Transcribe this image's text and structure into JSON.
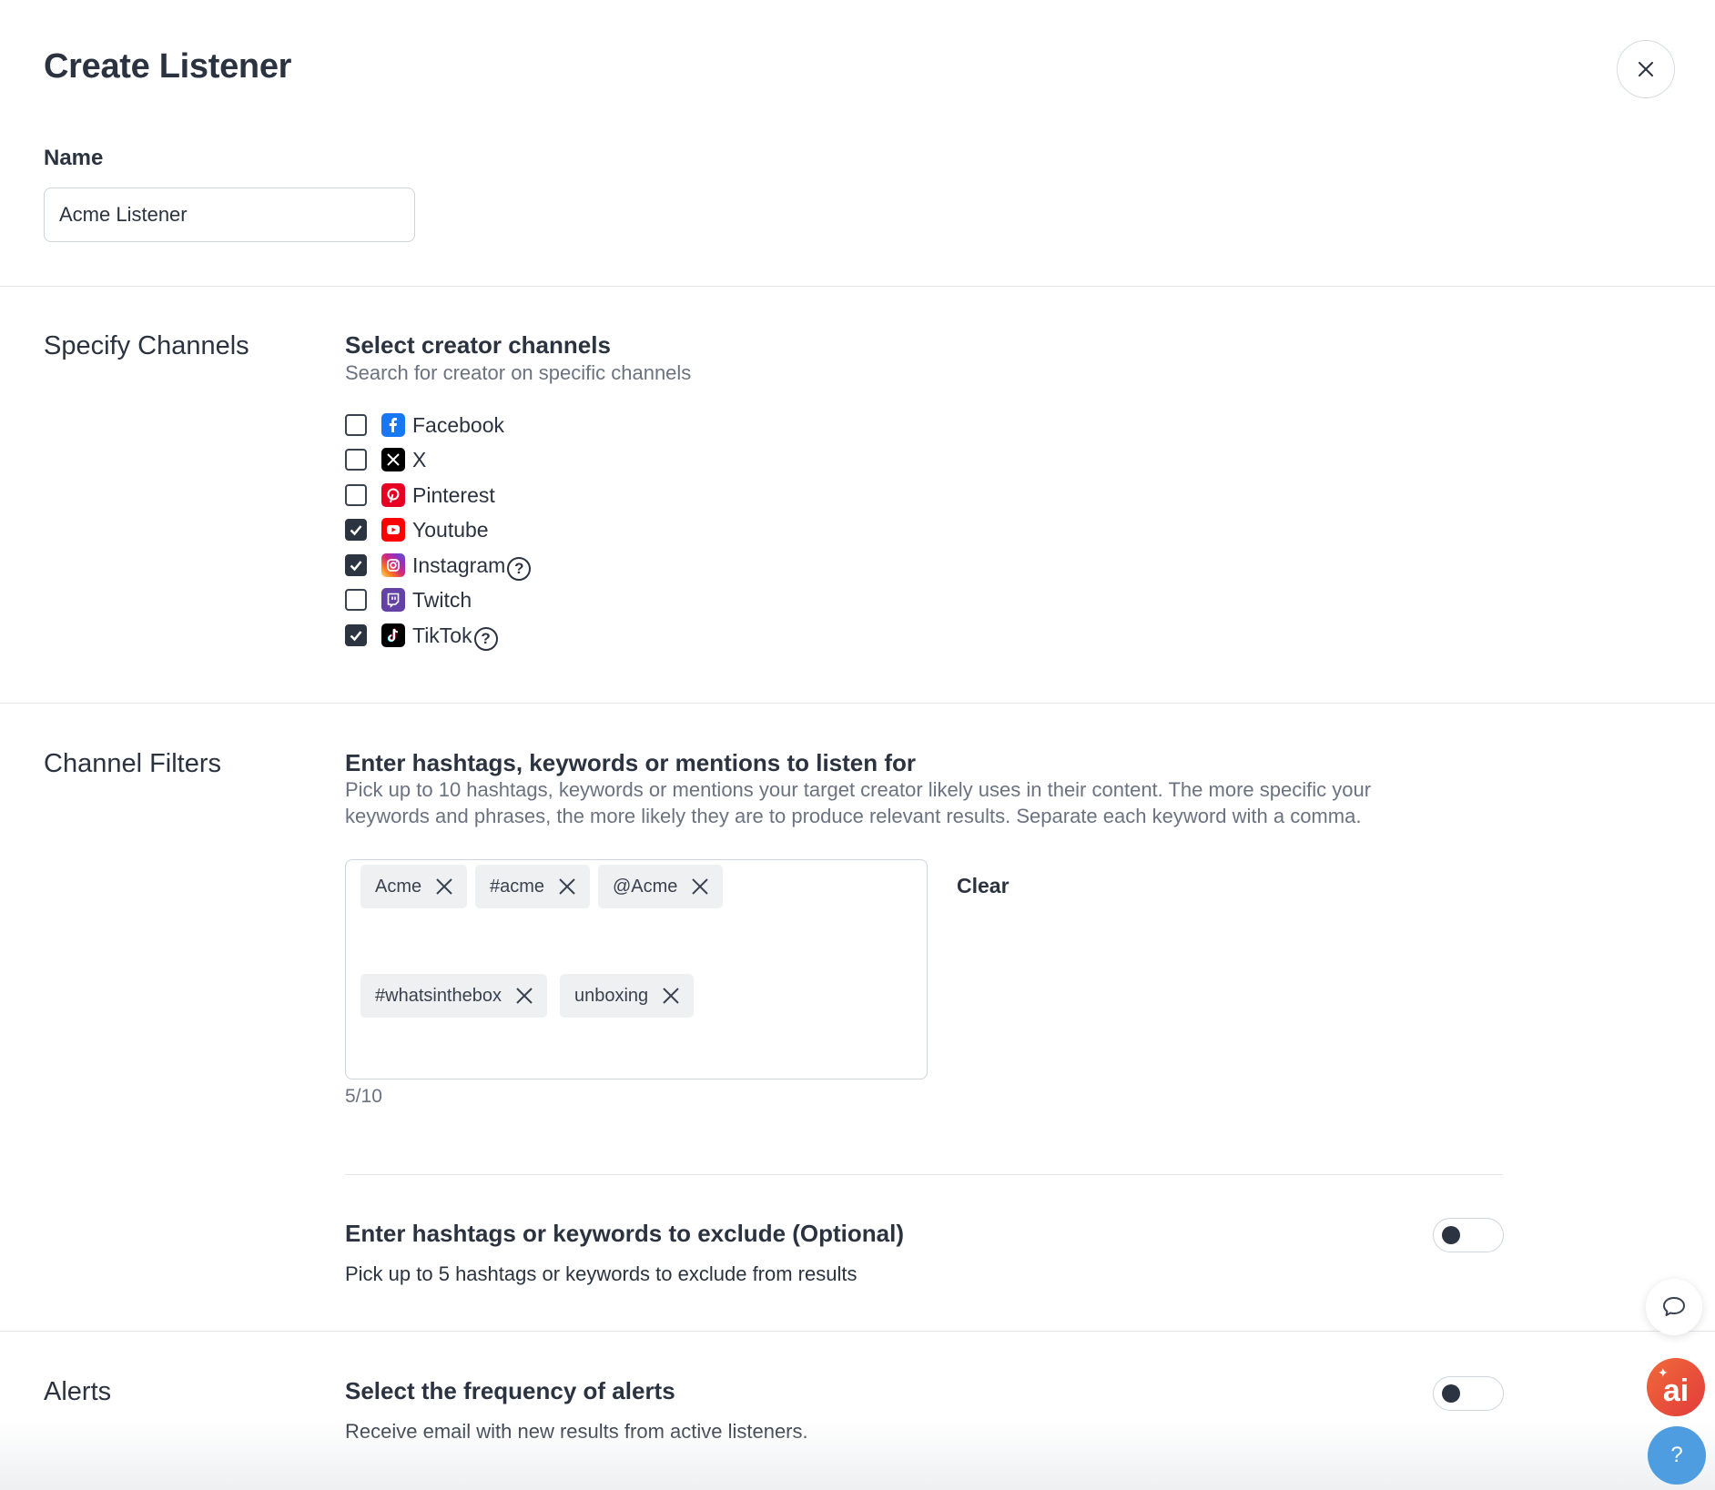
{
  "header": {
    "title": "Create Listener"
  },
  "name_field": {
    "label": "Name",
    "value": "Acme Listener"
  },
  "channels": {
    "section_title": "Specify Channels",
    "heading": "Select creator channels",
    "description": "Search for creator on specific channels",
    "items": [
      {
        "label": "Facebook",
        "checked": false,
        "icon": "facebook-icon",
        "color": "#1877f2",
        "help": false
      },
      {
        "label": "X",
        "checked": false,
        "icon": "x-icon",
        "color": "#000000",
        "help": false
      },
      {
        "label": "Pinterest",
        "checked": false,
        "icon": "pinterest-icon",
        "color": "#e60023",
        "help": false
      },
      {
        "label": "Youtube",
        "checked": true,
        "icon": "youtube-icon",
        "color": "#ff0000",
        "help": false
      },
      {
        "label": "Instagram",
        "checked": true,
        "icon": "instagram-icon",
        "color": "#d62976",
        "help": true
      },
      {
        "label": "Twitch",
        "checked": false,
        "icon": "twitch-icon",
        "color": "#6441a5",
        "help": false
      },
      {
        "label": "TikTok",
        "checked": true,
        "icon": "tiktok-icon",
        "color": "#000000",
        "help": true
      }
    ]
  },
  "filters": {
    "section_title": "Channel Filters",
    "heading": "Enter hashtags, keywords or mentions to listen for",
    "description_line1": "Pick up to 10 hashtags, keywords or mentions your target creator likely uses in their content. The more specific your",
    "description_line2": "keywords and phrases, the more likely they are to produce relevant results. Separate each keyword with a comma.",
    "tags": [
      "Acme",
      "#acme",
      "@Acme",
      "#whatsinthebox",
      "unboxing"
    ],
    "clear_label": "Clear",
    "counter": "5/10",
    "exclude_heading": "Enter hashtags or keywords to exclude (Optional)",
    "exclude_description": "Pick up to 5 hashtags or keywords to exclude from results",
    "exclude_enabled": false
  },
  "alerts": {
    "section_title": "Alerts",
    "heading": "Select the frequency of alerts",
    "description": "Receive email with new results from active listeners.",
    "enabled": false
  },
  "fabs": {
    "ai_label": "ai",
    "help_label": "?"
  },
  "colors": {
    "text": "#2b3340",
    "muted": "#6b7280",
    "border": "#cfd4da",
    "checkbox_checked": "#2d3441",
    "help_fab": "#4d9de0",
    "ai_fab": "#e8493a"
  }
}
